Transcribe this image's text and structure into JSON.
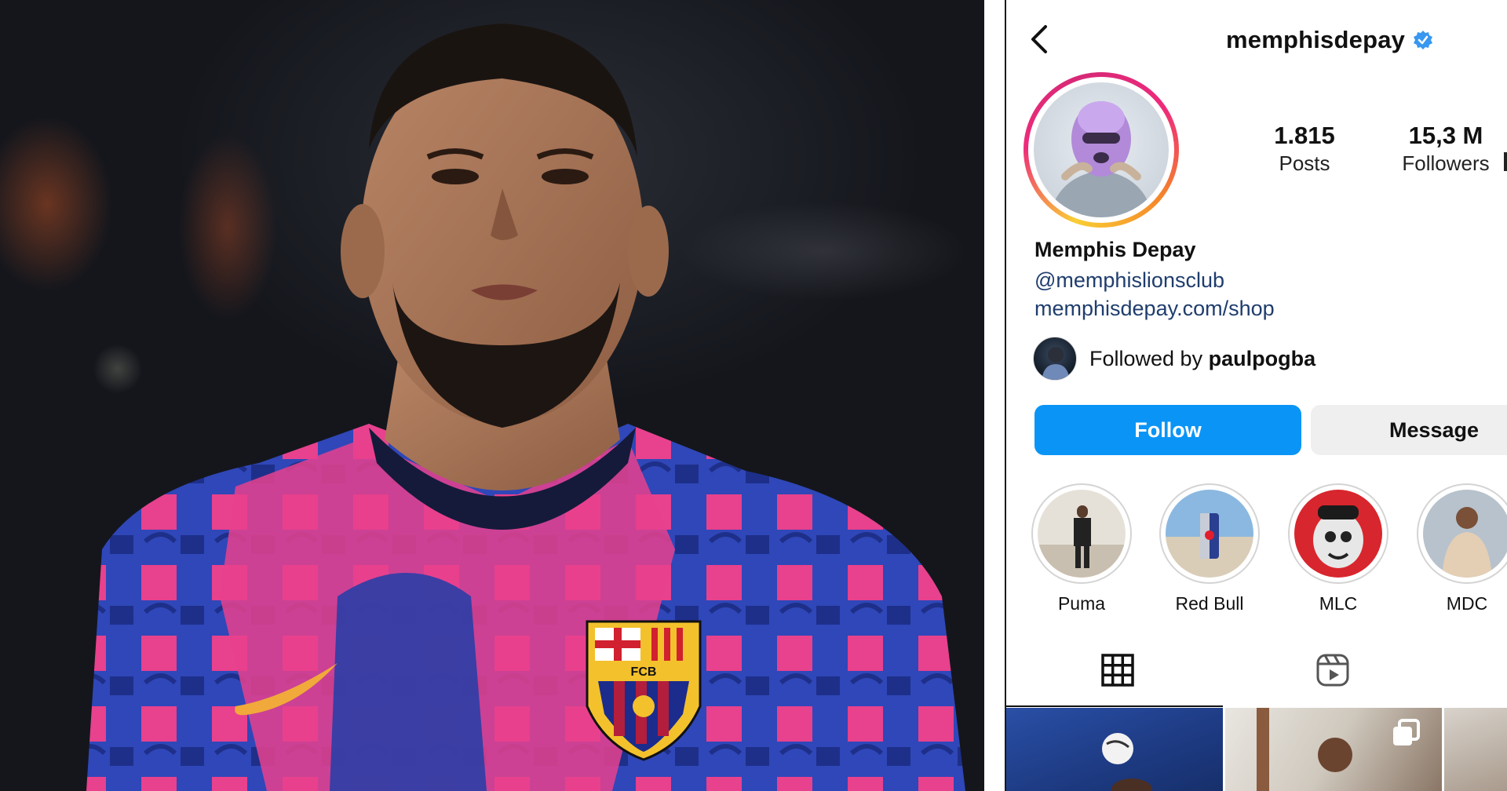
{
  "profile": {
    "username": "memphisdepay",
    "verified": true,
    "full_name": "Memphis Depay",
    "mention": "@memphislionsclub",
    "link": "memphisdepay.com/shop",
    "stats": [
      {
        "value": "1.815",
        "label": "Posts"
      },
      {
        "value": "15,3 M",
        "label": "Followers"
      }
    ],
    "followed_by": {
      "prefix": "Followed by",
      "user": "paulpogba"
    },
    "buttons": {
      "follow": "Follow",
      "message": "Message"
    },
    "highlights": [
      {
        "label": "Puma"
      },
      {
        "label": "Red Bull"
      },
      {
        "label": "MLC"
      },
      {
        "label": "MDC"
      }
    ],
    "tabs": [
      {
        "icon": "grid-icon",
        "active": true
      },
      {
        "icon": "reels-icon",
        "active": false
      }
    ]
  },
  "photo": {
    "crest_text": "FCB"
  },
  "colors": {
    "follow_button": "#0a95f6",
    "verified_badge": "#3897f0",
    "link": "#1f3d6d",
    "message_button": "#efefef",
    "story_ring_start": "#f9ce34",
    "story_ring_end": "#ee2a7b"
  }
}
